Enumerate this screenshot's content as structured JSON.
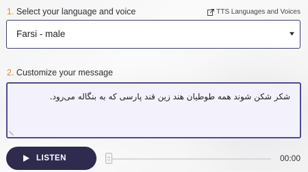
{
  "step1": {
    "number": "1.",
    "label": "Select your language and voice"
  },
  "tts_link": {
    "label": "TTS Languages and Voices",
    "icon": "external-link-icon"
  },
  "voice_select": {
    "selected": "Farsi - male",
    "icon": "caret-down-icon"
  },
  "step2": {
    "number": "2.",
    "label": "Customize your message"
  },
  "message": {
    "value": "شکر شکن شوند همه طوطیان هند  زین قند پارسی که به بنگاله می‌رود."
  },
  "player": {
    "listen_label": "LISTEN",
    "play_icon": "play-icon",
    "time": "00:00",
    "progress": 0
  },
  "colors": {
    "accent_orange": "#e08a2e",
    "button_dark": "#2e2b4f",
    "border_purple": "#4b4a8f"
  }
}
